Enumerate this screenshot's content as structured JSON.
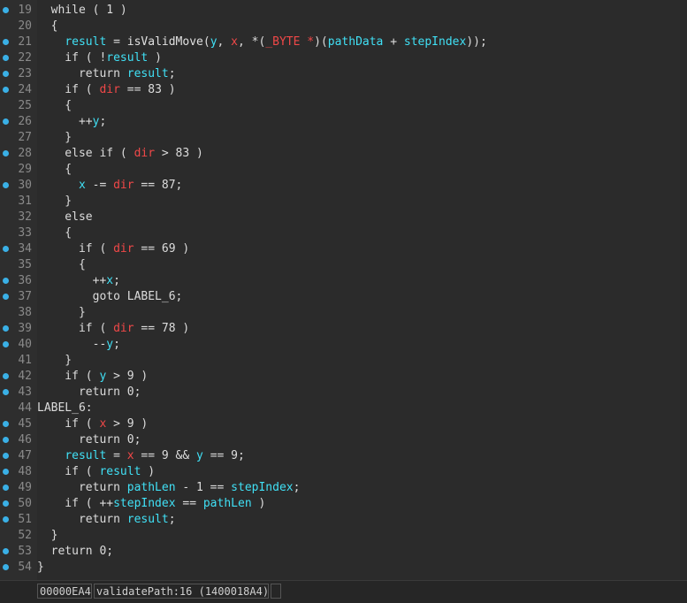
{
  "lines": [
    {
      "n": "19",
      "dot": true,
      "tokens": [
        [
          "plain",
          "  while ( 1 )"
        ]
      ]
    },
    {
      "n": "20",
      "dot": false,
      "tokens": [
        [
          "plain",
          "  {"
        ]
      ]
    },
    {
      "n": "21",
      "dot": true,
      "tokens": [
        [
          "plain",
          "    "
        ],
        [
          "var",
          "result"
        ],
        [
          "plain",
          " = "
        ],
        [
          "fn",
          "isValidMove"
        ],
        [
          "plain",
          "("
        ],
        [
          "var",
          "y"
        ],
        [
          "plain",
          ", "
        ],
        [
          "red",
          "x"
        ],
        [
          "plain",
          ", *("
        ],
        [
          "red",
          "_BYTE *"
        ],
        [
          "plain",
          ")("
        ],
        [
          "var",
          "pathData"
        ],
        [
          "plain",
          " + "
        ],
        [
          "var",
          "stepIndex"
        ],
        [
          "plain",
          "));"
        ]
      ]
    },
    {
      "n": "22",
      "dot": true,
      "tokens": [
        [
          "plain",
          "    if ( !"
        ],
        [
          "var",
          "result"
        ],
        [
          "plain",
          " )"
        ]
      ]
    },
    {
      "n": "23",
      "dot": true,
      "tokens": [
        [
          "plain",
          "      return "
        ],
        [
          "var",
          "result"
        ],
        [
          "plain",
          ";"
        ]
      ]
    },
    {
      "n": "24",
      "dot": true,
      "tokens": [
        [
          "plain",
          "    if ( "
        ],
        [
          "red",
          "dir"
        ],
        [
          "plain",
          " == 83 )"
        ]
      ]
    },
    {
      "n": "25",
      "dot": false,
      "tokens": [
        [
          "plain",
          "    {"
        ]
      ]
    },
    {
      "n": "26",
      "dot": true,
      "tokens": [
        [
          "plain",
          "      ++"
        ],
        [
          "var",
          "y"
        ],
        [
          "plain",
          ";"
        ]
      ]
    },
    {
      "n": "27",
      "dot": false,
      "tokens": [
        [
          "plain",
          "    }"
        ]
      ]
    },
    {
      "n": "28",
      "dot": true,
      "tokens": [
        [
          "plain",
          "    else if ( "
        ],
        [
          "red",
          "dir"
        ],
        [
          "plain",
          " > 83 )"
        ]
      ]
    },
    {
      "n": "29",
      "dot": false,
      "tokens": [
        [
          "plain",
          "    {"
        ]
      ]
    },
    {
      "n": "30",
      "dot": true,
      "tokens": [
        [
          "plain",
          "      "
        ],
        [
          "var",
          "x"
        ],
        [
          "plain",
          " -= "
        ],
        [
          "red",
          "dir"
        ],
        [
          "plain",
          " == 87;"
        ]
      ]
    },
    {
      "n": "31",
      "dot": false,
      "tokens": [
        [
          "plain",
          "    }"
        ]
      ]
    },
    {
      "n": "32",
      "dot": false,
      "tokens": [
        [
          "plain",
          "    else"
        ]
      ]
    },
    {
      "n": "33",
      "dot": false,
      "tokens": [
        [
          "plain",
          "    {"
        ]
      ]
    },
    {
      "n": "34",
      "dot": true,
      "tokens": [
        [
          "plain",
          "      if ( "
        ],
        [
          "red",
          "dir"
        ],
        [
          "plain",
          " == 69 )"
        ]
      ]
    },
    {
      "n": "35",
      "dot": false,
      "tokens": [
        [
          "plain",
          "      {"
        ]
      ]
    },
    {
      "n": "36",
      "dot": true,
      "tokens": [
        [
          "plain",
          "        ++"
        ],
        [
          "var",
          "x"
        ],
        [
          "plain",
          ";"
        ]
      ]
    },
    {
      "n": "37",
      "dot": true,
      "tokens": [
        [
          "plain",
          "        goto LABEL_6;"
        ]
      ]
    },
    {
      "n": "38",
      "dot": false,
      "tokens": [
        [
          "plain",
          "      }"
        ]
      ]
    },
    {
      "n": "39",
      "dot": true,
      "tokens": [
        [
          "plain",
          "      if ( "
        ],
        [
          "red",
          "dir"
        ],
        [
          "plain",
          " == 78 )"
        ]
      ]
    },
    {
      "n": "40",
      "dot": true,
      "tokens": [
        [
          "plain",
          "        --"
        ],
        [
          "var",
          "y"
        ],
        [
          "plain",
          ";"
        ]
      ]
    },
    {
      "n": "41",
      "dot": false,
      "tokens": [
        [
          "plain",
          "    }"
        ]
      ]
    },
    {
      "n": "42",
      "dot": true,
      "tokens": [
        [
          "plain",
          "    if ( "
        ],
        [
          "var",
          "y"
        ],
        [
          "plain",
          " > 9 )"
        ]
      ]
    },
    {
      "n": "43",
      "dot": true,
      "tokens": [
        [
          "plain",
          "      return 0;"
        ]
      ]
    },
    {
      "n": "44",
      "dot": false,
      "tokens": [
        [
          "plain",
          "LABEL_6:"
        ]
      ]
    },
    {
      "n": "45",
      "dot": true,
      "tokens": [
        [
          "plain",
          "    if ( "
        ],
        [
          "red",
          "x"
        ],
        [
          "plain",
          " > 9 )"
        ]
      ]
    },
    {
      "n": "46",
      "dot": true,
      "tokens": [
        [
          "plain",
          "      return 0;"
        ]
      ]
    },
    {
      "n": "47",
      "dot": true,
      "tokens": [
        [
          "plain",
          "    "
        ],
        [
          "var",
          "result"
        ],
        [
          "plain",
          " = "
        ],
        [
          "red",
          "x"
        ],
        [
          "plain",
          " == 9 && "
        ],
        [
          "var",
          "y"
        ],
        [
          "plain",
          " == 9;"
        ]
      ]
    },
    {
      "n": "48",
      "dot": true,
      "tokens": [
        [
          "plain",
          "    if ( "
        ],
        [
          "var",
          "result"
        ],
        [
          "plain",
          " )"
        ]
      ]
    },
    {
      "n": "49",
      "dot": true,
      "tokens": [
        [
          "plain",
          "      return "
        ],
        [
          "var",
          "pathLen"
        ],
        [
          "plain",
          " - 1 == "
        ],
        [
          "var",
          "stepIndex"
        ],
        [
          "plain",
          ";"
        ]
      ]
    },
    {
      "n": "50",
      "dot": true,
      "tokens": [
        [
          "plain",
          "    if ( ++"
        ],
        [
          "var",
          "stepIndex"
        ],
        [
          "plain",
          " == "
        ],
        [
          "var",
          "pathLen"
        ],
        [
          "plain",
          " )"
        ]
      ]
    },
    {
      "n": "51",
      "dot": true,
      "tokens": [
        [
          "plain",
          "      return "
        ],
        [
          "var",
          "result"
        ],
        [
          "plain",
          ";"
        ]
      ]
    },
    {
      "n": "52",
      "dot": false,
      "tokens": [
        [
          "plain",
          "  }"
        ]
      ]
    },
    {
      "n": "53",
      "dot": true,
      "tokens": [
        [
          "plain",
          "  return 0;"
        ]
      ]
    },
    {
      "n": "54",
      "dot": true,
      "tokens": [
        [
          "plain",
          "}"
        ]
      ]
    }
  ],
  "status": {
    "address": "00000EA4",
    "location": "validatePath:16 (1400018A4)",
    "extra": ""
  },
  "colors": {
    "background": "#2b2b2b",
    "variable": "#40e0f5",
    "local_red": "#f04848",
    "breakpoint_dot": "#3ab0e6"
  },
  "icons": {
    "gutter_marker": "execution-dot-icon"
  }
}
